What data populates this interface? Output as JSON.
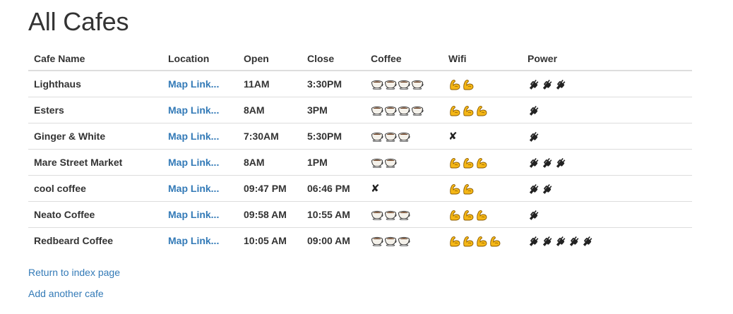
{
  "page": {
    "title": "All Cafes"
  },
  "table": {
    "headers": [
      "Cafe Name",
      "Location",
      "Open",
      "Close",
      "Coffee",
      "Wifi",
      "Power"
    ],
    "rows": [
      {
        "name": "Lighthaus",
        "location": "Map Link...",
        "open": "11AM",
        "close": "3:30PM",
        "coffee": 4,
        "wifi": 2,
        "power": 3
      },
      {
        "name": "Esters",
        "location": "Map Link...",
        "open": "8AM",
        "close": "3PM",
        "coffee": 4,
        "wifi": 3,
        "power": 1
      },
      {
        "name": "Ginger & White",
        "location": "Map Link...",
        "open": "7:30AM",
        "close": "5:30PM",
        "coffee": 3,
        "wifi": 0,
        "power": 1
      },
      {
        "name": "Mare Street Market",
        "location": "Map Link...",
        "open": "8AM",
        "close": "1PM",
        "coffee": 2,
        "wifi": 3,
        "power": 3
      },
      {
        "name": "cool coffee",
        "location": "Map Link...",
        "open": "09:47 PM",
        "close": "06:46 PM",
        "coffee": 0,
        "wifi": 2,
        "power": 2
      },
      {
        "name": "Neato Coffee",
        "location": "Map Link...",
        "open": "09:58 AM",
        "close": "10:55 AM",
        "coffee": 3,
        "wifi": 3,
        "power": 1
      },
      {
        "name": "Redbeard Coffee",
        "location": "Map Link...",
        "open": "10:05 AM",
        "close": "09:00 AM",
        "coffee": 3,
        "wifi": 4,
        "power": 5
      }
    ]
  },
  "none_symbol": "✘",
  "icons": {
    "coffee": "coffee-cup-icon",
    "wifi": "flexed-biceps-icon",
    "power": "electric-plug-icon"
  },
  "colors": {
    "link": "#337ab7",
    "biceps": "#f5b716"
  },
  "links": {
    "return_label": "Return to index page",
    "add_label": "Add another cafe"
  }
}
